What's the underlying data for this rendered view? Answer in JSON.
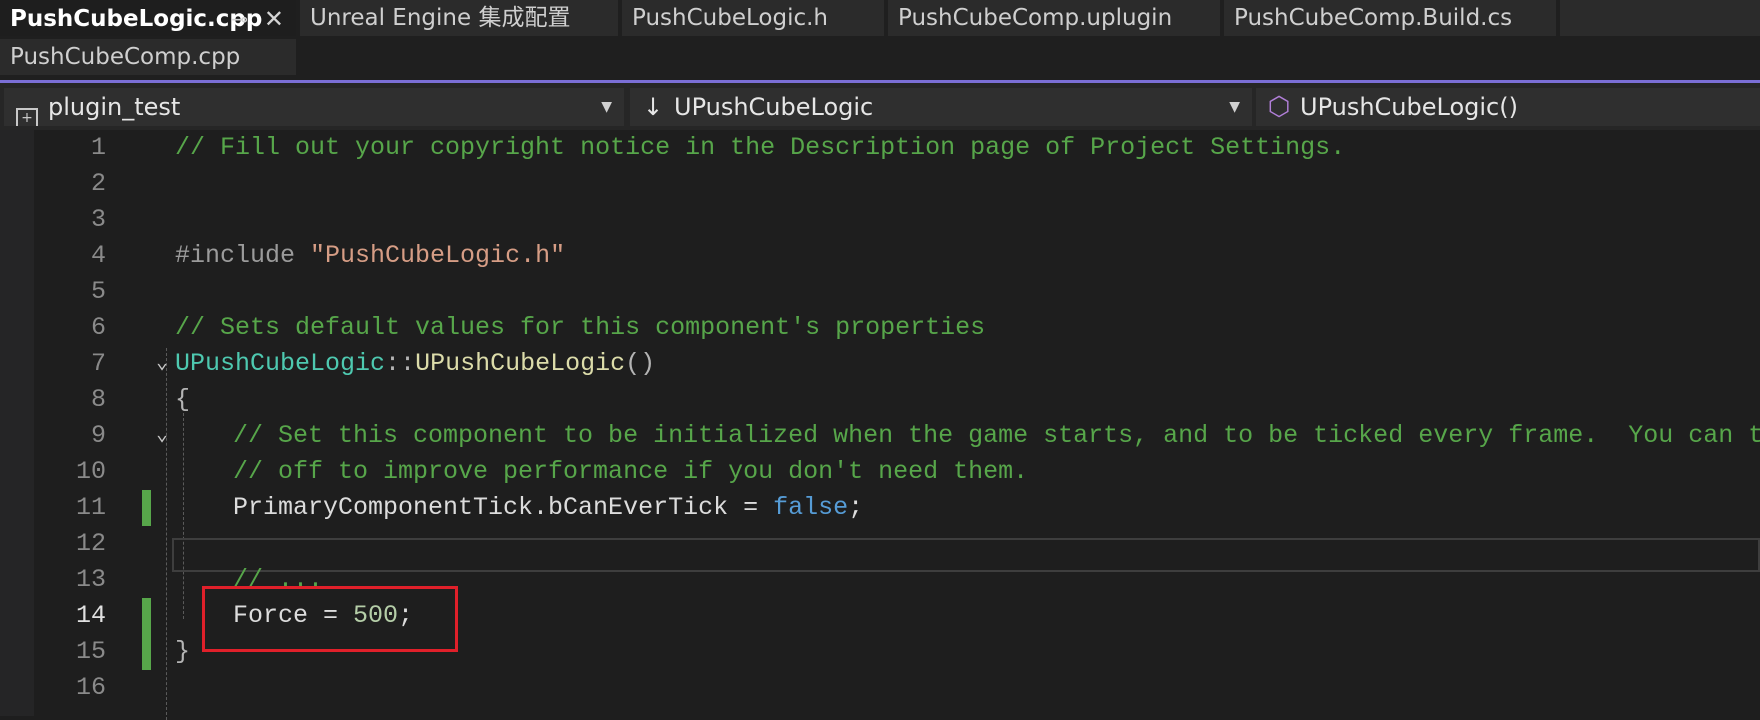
{
  "tabs": [
    {
      "label": "PushCubeLogic.cpp",
      "active": true,
      "pin_icon": "pin-icon",
      "close_icon": "close-icon"
    },
    {
      "label": "Unreal Engine 集成配置",
      "active": false
    },
    {
      "label": "PushCubeLogic.h",
      "active": false
    },
    {
      "label": "PushCubeComp.uplugin",
      "active": false
    },
    {
      "label": "PushCubeComp.Build.cs",
      "active": false
    },
    {
      "label": "PushCubeComp.cpp",
      "active": false
    }
  ],
  "nav": {
    "project": "plugin_test",
    "scope": "UPushCubeLogic",
    "member": "UPushCubeLogic()"
  },
  "editor": {
    "current_line": 14,
    "line_numbers": [
      "1",
      "2",
      "3",
      "4",
      "5",
      "6",
      "7",
      "8",
      "9",
      "10",
      "11",
      "12",
      "13",
      "14",
      "15",
      "16"
    ],
    "line1": "// Fill out your copyright notice in the Description page of Project Settings.",
    "line4_directive": "#include ",
    "line4_string": "\"PushCubeLogic.h\"",
    "line6": "// Sets default values for this component's properties",
    "line7_class": "UPushCubeLogic",
    "line7_scope": "::",
    "line7_fn": "UPushCubeLogic",
    "line7_parens": "()",
    "line8": "{",
    "line9": "// Set this component to be initialized when the game starts, and to be ticked every frame.  You can turn",
    "line10": "// off to improve performance if you don't need them.",
    "line11_member": "PrimaryComponentTick.bCanEverTick = ",
    "line11_value": "false",
    "line11_end": ";",
    "line13": "// ...",
    "line14_lhs": "Force = ",
    "line14_value": "500",
    "line14_end": ";",
    "line15": "}"
  },
  "colors": {
    "accent": "#7b6fd6",
    "comment": "#57a64a",
    "keyword": "#569cd6",
    "type": "#4ec9b0",
    "highlight_box": "#e0202a",
    "change_marker": "#57a64a"
  }
}
